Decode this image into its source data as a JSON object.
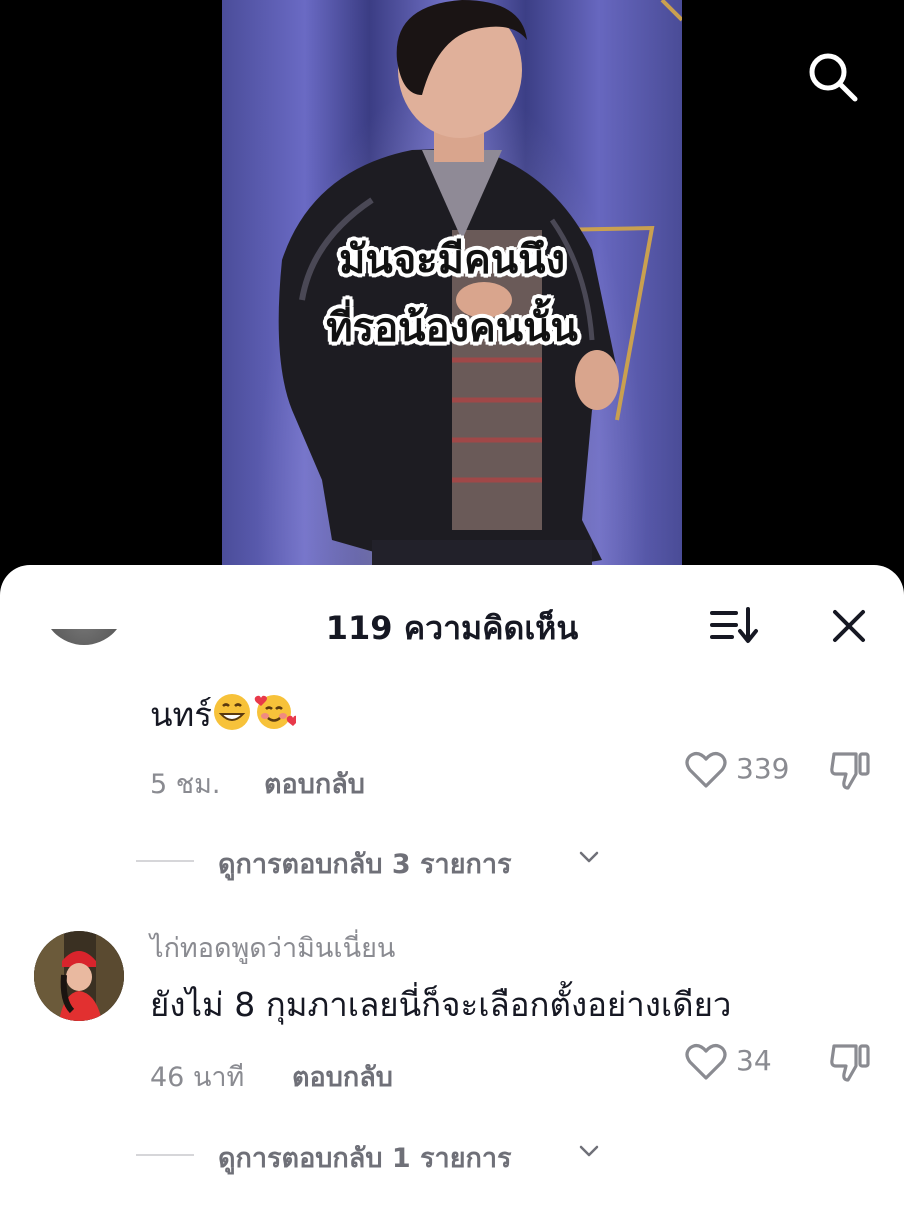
{
  "video": {
    "caption_line1": "มันจะมีคนนึง",
    "caption_line2": "ที่รอน้องคนนั้น"
  },
  "icons": {
    "search": "search-icon",
    "sort": "sort-icon",
    "close": "close-icon",
    "like": "heart-icon",
    "dislike": "dislike-icon",
    "chevron": "chevron-down-icon"
  },
  "sheet": {
    "title": "119 ความคิดเห็น"
  },
  "comments": [
    {
      "username": "",
      "text": "นทร์",
      "emojis": [
        "grinning-face",
        "smiling-face-with-hearts"
      ],
      "time": "5 ชม.",
      "reply_label": "ตอบกลับ",
      "likes": "339",
      "view_replies": "ดูการตอบกลับ 3 รายการ"
    },
    {
      "username": "ไก่ทอดพูดว่ามินเนี่ยน",
      "text": "ยังไม่ 8 กุมภาเลยนี่ก็จะเลือกตั้งอย่างเดียว",
      "time": "46 นาที",
      "reply_label": "ตอบกลับ",
      "likes": "34",
      "view_replies": "ดูการตอบกลับ 1 รายการ"
    }
  ],
  "colors": {
    "text_primary": "#161823",
    "text_secondary": "#8a8b91",
    "sheet_bg": "#ffffff",
    "divider": "#d6d6d9"
  }
}
